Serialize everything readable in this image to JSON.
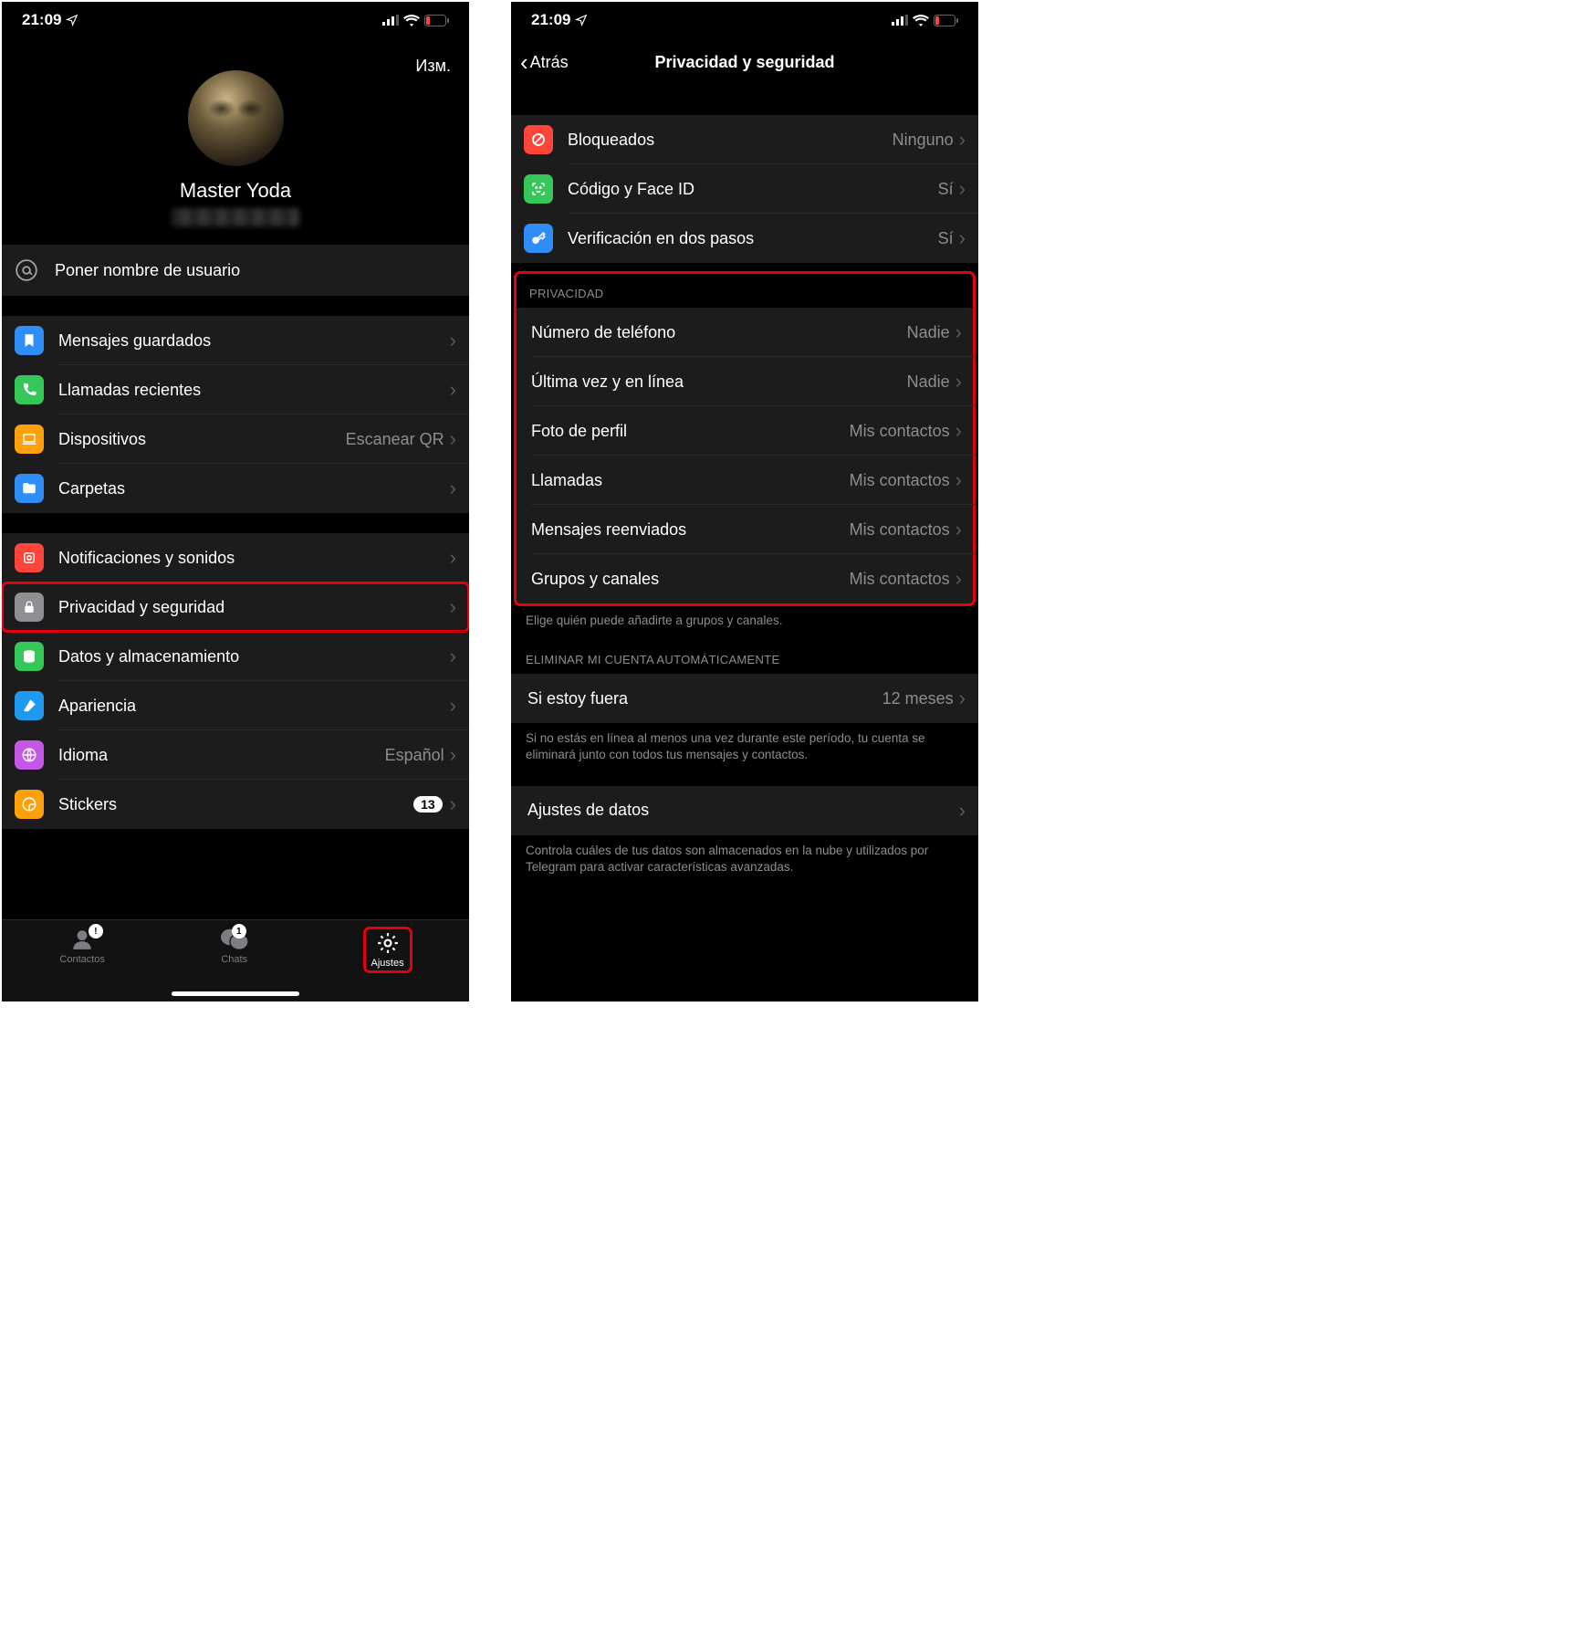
{
  "status": {
    "time": "21:09"
  },
  "left": {
    "edit": "Изм.",
    "profile_name": "Master Yoda",
    "username_row": {
      "label": "Poner nombre de usuario"
    },
    "group1": [
      {
        "icon": "bookmark",
        "bg": "#2e8df7",
        "label": "Mensajes guardados"
      },
      {
        "icon": "phone",
        "bg": "#36c759",
        "label": "Llamadas recientes"
      },
      {
        "icon": "laptop",
        "bg": "#ff9f0a",
        "label": "Dispositivos",
        "value": "Escanear QR"
      },
      {
        "icon": "folder",
        "bg": "#2e8df7",
        "label": "Carpetas"
      }
    ],
    "group2": [
      {
        "icon": "bell",
        "bg": "#ff453a",
        "label": "Notificaciones y sonidos"
      },
      {
        "icon": "lock",
        "bg": "#8e8e93",
        "label": "Privacidad y seguridad",
        "highlight": true
      },
      {
        "icon": "data",
        "bg": "#36c759",
        "label": "Datos y almacenamiento"
      },
      {
        "icon": "brush",
        "bg": "#1e9bf0",
        "label": "Apariencia"
      },
      {
        "icon": "globe",
        "bg": "#c456e8",
        "label": "Idioma",
        "value": "Español"
      },
      {
        "icon": "sticker",
        "bg": "#ff9f0a",
        "label": "Stickers",
        "badge": "13"
      }
    ],
    "tabs": {
      "contacts": "Contactos",
      "chats": "Chats",
      "chats_badge": "1",
      "settings": "Ajustes"
    }
  },
  "right": {
    "back": "Atrás",
    "title": "Privacidad y seguridad",
    "security": [
      {
        "icon": "block",
        "bg": "#ff453a",
        "label": "Bloqueados",
        "value": "Ninguno"
      },
      {
        "icon": "faceid",
        "bg": "#36c759",
        "label": "Código y Face ID",
        "value": "Sí"
      },
      {
        "icon": "key",
        "bg": "#2e8df7",
        "label": "Verificación en dos pasos",
        "value": "Sí"
      }
    ],
    "privacy_header": "PRIVACIDAD",
    "privacy": [
      {
        "label": "Número de teléfono",
        "value": "Nadie"
      },
      {
        "label": "Última vez y en línea",
        "value": "Nadie"
      },
      {
        "label": "Foto de perfil",
        "value": "Mis contactos"
      },
      {
        "label": "Llamadas",
        "value": "Mis contactos"
      },
      {
        "label": "Mensajes reenviados",
        "value": "Mis contactos"
      },
      {
        "label": "Grupos y canales",
        "value": "Mis contactos"
      }
    ],
    "privacy_footer": "Elige quién puede añadirte a grupos y canales.",
    "delete_header": "ELIMINAR MI CUENTA AUTOMÁTICAMENTE",
    "delete_row": {
      "label": "Si estoy fuera",
      "value": "12 meses"
    },
    "delete_footer": "Si no estás en línea al menos una vez durante este período, tu cuenta se eliminará junto con todos tus mensajes y contactos.",
    "data_row": {
      "label": "Ajustes de datos"
    },
    "data_footer": "Controla cuáles de tus datos son almacenados en la nube y utilizados por Telegram para activar características avanzadas."
  }
}
